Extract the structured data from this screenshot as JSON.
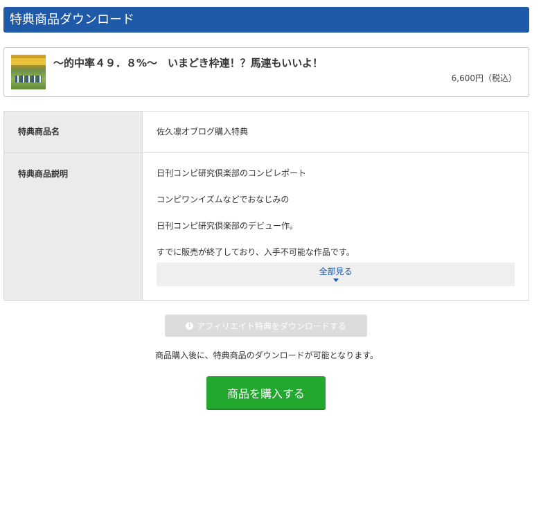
{
  "header": {
    "title": "特典商品ダウンロード"
  },
  "product": {
    "title": "〜的中率４９．８%〜　いまどき枠連！？馬連もいいよ！",
    "price": "6,600円（税込）"
  },
  "details": {
    "name_label": "特典商品名",
    "name_value": "佐久凛才ブログ購入特典",
    "desc_label": "特典商品説明",
    "desc_lines": [
      "日刊コンピ研究倶楽部のコンピレポート",
      "コンピワンイズムなどでおなじみの",
      "日刊コンピ研究倶楽部のデビュー作。",
      "すでに販売が終了しており、入手不可能な作品です。"
    ],
    "see_all": "全部見る"
  },
  "actions": {
    "download_label": "アフィリエイト特典をダウンロードする",
    "note": "商品購入後に、特典商品のダウンロードが可能となります。",
    "buy_label": "商品を購入する"
  },
  "colors": {
    "header_bg": "#1f5aa8",
    "buy_button": "#22a72f",
    "disabled_button": "#dcdcdc",
    "link": "#1f5aa8"
  },
  "icons": {
    "download": "info-icon",
    "see_all": "caret-down-icon"
  }
}
